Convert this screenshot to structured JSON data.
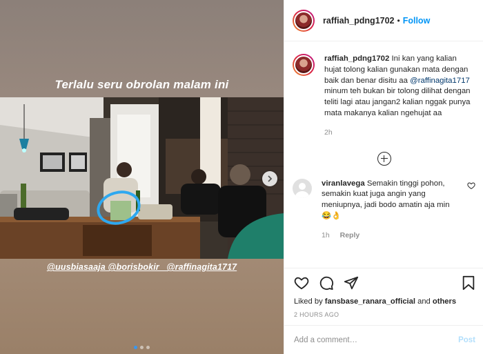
{
  "post": {
    "overlay_caption": "Terlalu seru obrolan malam ini",
    "tags_line": "@uusbiasaaja @borisbokir_ @raffinagita1717",
    "carousel": {
      "total": 3,
      "active_index": 0
    }
  },
  "header": {
    "username": "raffiah_pdng1702",
    "separator": "•",
    "follow_label": "Follow"
  },
  "caption": {
    "username": "raffiah_pdng1702",
    "text_before_mention": "Ini kan yang kalian hujat tolong kalian gunakan mata dengan baik dan benar disitu aa",
    "mention": "@raffinagita1717",
    "text_after_mention": "minum teh bukan bir tolong dilihat dengan teliti lagi atau jangan2 kalian nggak punya mata makanya kalian ngehujat aa",
    "time": "2h"
  },
  "comments": [
    {
      "username": "viranlavega",
      "text": "Semakin tinggi pohon, semakin kuat juga angin yang meniupnya, jadi bodo amatin aja min",
      "emoji": "😂👌",
      "time": "1h",
      "reply_label": "Reply"
    }
  ],
  "likes": {
    "prefix": "Liked by",
    "user": "fansbase_ranara_official",
    "and": "and",
    "others": "others"
  },
  "date": "2 HOURS AGO",
  "add_comment": {
    "placeholder": "Add a comment…",
    "post_label": "Post"
  },
  "colors": {
    "link_blue": "#0095f6",
    "text": "#262626",
    "muted": "#8e8e8e",
    "highlight_circle": "#2ea8f0"
  }
}
